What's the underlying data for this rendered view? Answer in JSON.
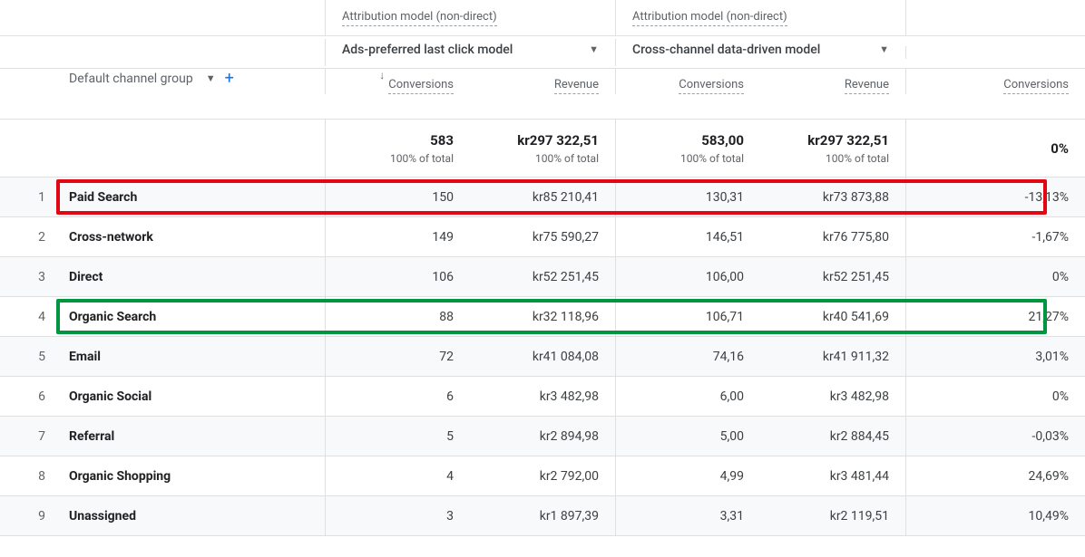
{
  "header": {
    "group_label": "Attribution model (non-direct)",
    "model1_label": "Ads-preferred last click model",
    "model2_label": "Cross-channel data-driven model",
    "dimension_label": "Default channel group",
    "metric_conversions": "Conversions",
    "metric_revenue": "Revenue",
    "metric_conv_pct": "Conversions"
  },
  "totals": {
    "m1_conv": "583",
    "m1_rev": "kr297 322,51",
    "m2_conv": "583,00",
    "m2_rev": "kr297 322,51",
    "pct": "0%",
    "sub": "100% of total"
  },
  "rows": [
    {
      "idx": "1",
      "dim": "Paid Search",
      "m1c": "150",
      "m1r": "kr85 210,41",
      "m2c": "130,31",
      "m2r": "kr73 873,88",
      "pct": "-13,13%",
      "hl": "red"
    },
    {
      "idx": "2",
      "dim": "Cross-network",
      "m1c": "149",
      "m1r": "kr75 590,27",
      "m2c": "146,51",
      "m2r": "kr76 775,80",
      "pct": "-1,67%"
    },
    {
      "idx": "3",
      "dim": "Direct",
      "m1c": "106",
      "m1r": "kr52 251,45",
      "m2c": "106,00",
      "m2r": "kr52 251,45",
      "pct": "0%"
    },
    {
      "idx": "4",
      "dim": "Organic Search",
      "m1c": "88",
      "m1r": "kr32 118,96",
      "m2c": "106,71",
      "m2r": "kr40 541,69",
      "pct": "21,27%",
      "hl": "green"
    },
    {
      "idx": "5",
      "dim": "Email",
      "m1c": "72",
      "m1r": "kr41 084,08",
      "m2c": "74,16",
      "m2r": "kr41 911,32",
      "pct": "3,01%"
    },
    {
      "idx": "6",
      "dim": "Organic Social",
      "m1c": "6",
      "m1r": "kr3 482,98",
      "m2c": "6,00",
      "m2r": "kr3 482,98",
      "pct": "0%"
    },
    {
      "idx": "7",
      "dim": "Referral",
      "m1c": "5",
      "m1r": "kr2 894,98",
      "m2c": "5,00",
      "m2r": "kr2 884,45",
      "pct": "-0,03%"
    },
    {
      "idx": "8",
      "dim": "Organic Shopping",
      "m1c": "4",
      "m1r": "kr2 792,00",
      "m2c": "4,99",
      "m2r": "kr3 481,44",
      "pct": "24,69%"
    },
    {
      "idx": "9",
      "dim": "Unassigned",
      "m1c": "3",
      "m1r": "kr1 897,39",
      "m2c": "3,31",
      "m2r": "kr2 119,51",
      "pct": "10,49%"
    }
  ]
}
